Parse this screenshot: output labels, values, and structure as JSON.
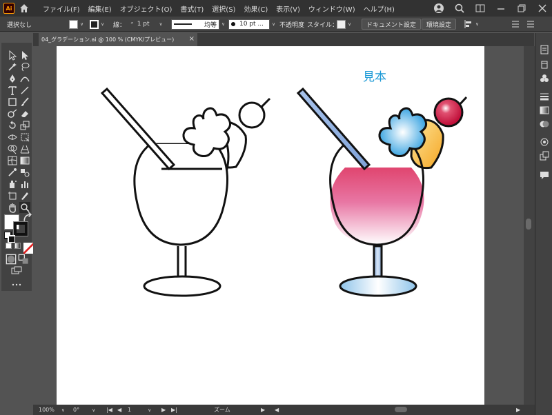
{
  "app": {
    "logo": "Ai"
  },
  "menu": [
    "ファイル(F)",
    "編集(E)",
    "オブジェクト(O)",
    "書式(T)",
    "選択(S)",
    "効果(C)",
    "表示(V)",
    "ウィンドウ(W)",
    "ヘルプ(H)"
  ],
  "control": {
    "selection": "選択なし",
    "stroke_label": "線：",
    "stroke_weight": "1 pt",
    "stroke_profile": "均等",
    "brush": "10 pt ...",
    "opacity_label": "不透明度",
    "style_label": "スタイル：",
    "doc_setup": "ドキュメント設定",
    "prefs": "環境設定"
  },
  "tab": {
    "title": "04_グラデーション.ai @ 100 % (CMYK/プレビュー)",
    "close": "×"
  },
  "artboard": {
    "sample_label": "見本"
  },
  "status": {
    "zoom": "100%",
    "rotate": "0°",
    "artboard_num": "1",
    "tool": "ズーム"
  },
  "colors": {
    "accent": "#1d9ad6",
    "cherry": "#d81b4a",
    "flower_blue": "#3aa8e0",
    "drink_pink": "#e0456f",
    "straw_blue": "#9ab8e6",
    "lemon": "#f7c85a"
  }
}
